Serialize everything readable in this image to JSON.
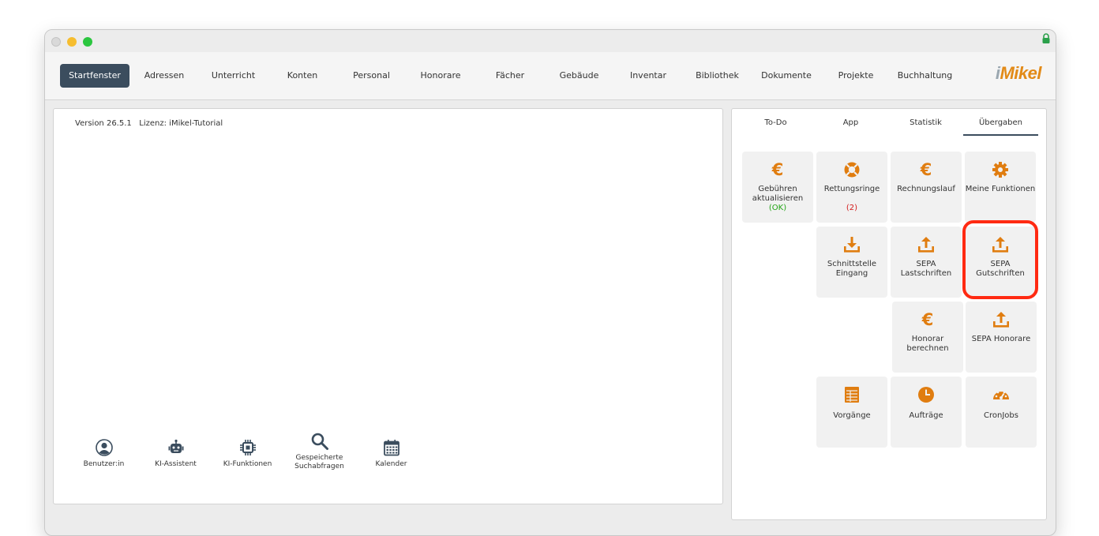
{
  "window": {
    "traffic_lights": [
      "close",
      "minimize",
      "maximize"
    ],
    "lock_icon": "lock-icon"
  },
  "nav": {
    "items": [
      {
        "label": "Startfenster",
        "active": true
      },
      {
        "label": "Adressen"
      },
      {
        "label": "Unterricht"
      },
      {
        "label": "Konten"
      },
      {
        "label": "Personal"
      },
      {
        "label": "Honorare"
      },
      {
        "label": "Fächer"
      },
      {
        "label": "Gebäude"
      },
      {
        "label": "Inventar"
      },
      {
        "label": "Bibliothek"
      },
      {
        "label": "Dokumente"
      },
      {
        "label": "Projekte"
      },
      {
        "label": "Buchhaltung"
      }
    ],
    "logo": {
      "prefix": "i",
      "name": "Mikel"
    }
  },
  "left_panel": {
    "version": "Version 26.5.1   Lizenz: iMikel-Tutorial",
    "quick_actions": [
      {
        "label": "Benutzer:in",
        "icon": "user-circle-icon"
      },
      {
        "label": "KI-Assistent",
        "icon": "robot-icon"
      },
      {
        "label": "KI-Funktionen",
        "icon": "chip-icon"
      },
      {
        "label": "Gespeicherte Suchabfragen",
        "icon": "search-icon"
      },
      {
        "label": "Kalender",
        "icon": "calendar-icon"
      }
    ]
  },
  "right_panel": {
    "tabs": [
      {
        "label": "To-Do"
      },
      {
        "label": "App"
      },
      {
        "label": "Statistik"
      },
      {
        "label": "Übergaben",
        "active": true
      }
    ],
    "tiles": {
      "gebuehren": {
        "label": "Gebühren aktualisieren",
        "status": "(OK)",
        "icon": "euro-icon"
      },
      "rettungsringe": {
        "label": "Rettungsringe",
        "status": "(2)",
        "icon": "lifebuoy-icon"
      },
      "rechnungslauf": {
        "label": "Rechnungslauf",
        "icon": "euro-icon"
      },
      "meine_funktionen": {
        "label": "Meine Funktionen",
        "icon": "gear-icon"
      },
      "schnittstelle": {
        "label": "Schnittstelle Eingang",
        "icon": "download-icon"
      },
      "sepa_last": {
        "label": "SEPA Lastschriften",
        "icon": "upload-icon"
      },
      "sepa_gut": {
        "label": "SEPA Gutschriften",
        "icon": "upload-icon",
        "highlighted": true
      },
      "honorar_berechnen": {
        "label": "Honorar berechnen",
        "icon": "euro-icon"
      },
      "sepa_honorare": {
        "label": "SEPA Honorare",
        "icon": "upload-icon"
      },
      "vorgaenge": {
        "label": "Vorgänge",
        "icon": "spreadsheet-icon"
      },
      "auftraege": {
        "label": "Aufträge",
        "icon": "clock-icon"
      },
      "cronjobs": {
        "label": "CronJobs",
        "icon": "gauge-icon"
      }
    },
    "euro_symbol": "€"
  },
  "colors": {
    "accent": "#e07d10",
    "nav_active": "#3b4d5e",
    "ok": "#22a515",
    "alert": "#d31b1b",
    "highlight": "#ff2a12"
  }
}
